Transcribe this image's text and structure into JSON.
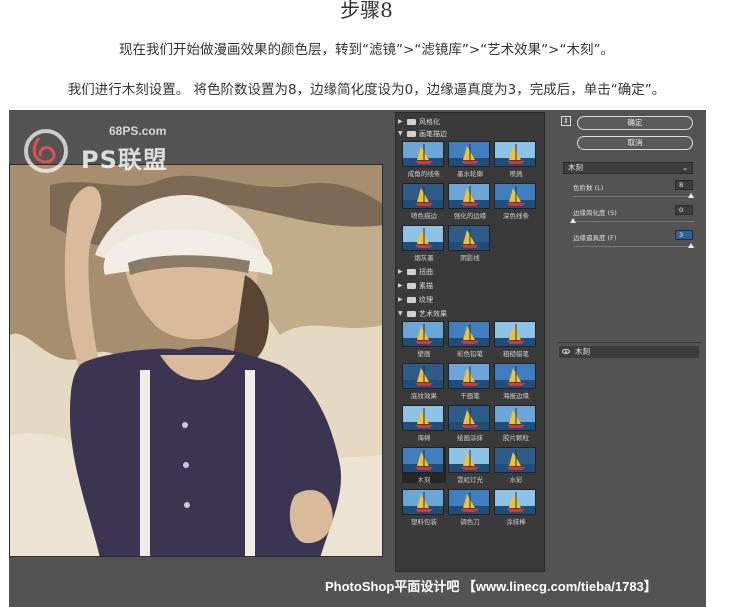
{
  "article": {
    "step_title": "步骤8",
    "paragraph1": "现在我们开始做漫画效果的颜色层，转到“滤镜”>“滤镜库”>“艺术效果”>“木刻”。",
    "paragraph2": "我们进行木刻设置。 将色阶数设置为8，边缘简化度设为0，边缘逼真度为3，完成后，单击“确定”。"
  },
  "watermark": {
    "site": "68PS.com",
    "brand": "PS联盟",
    "bottom_text": "PhotoShop平面设计吧 【www.linecg.com/tieba/1783】"
  },
  "filter_gallery": {
    "categories": [
      {
        "label": "风格化",
        "expanded": false
      },
      {
        "label": "画笔描边",
        "expanded": true,
        "items": [
          "成角的线条",
          "墨水轮廓",
          "喷溅",
          "喷色描边",
          "强化的边缘",
          "深色线条",
          "烟灰墨",
          "阴影线"
        ]
      },
      {
        "label": "扭曲",
        "expanded": false
      },
      {
        "label": "素描",
        "expanded": false
      },
      {
        "label": "纹理",
        "expanded": false
      },
      {
        "label": "艺术效果",
        "expanded": true,
        "items": [
          "壁画",
          "彩色铅笔",
          "粗糙蜡笔",
          "底纹效果",
          "干画笔",
          "海报边缘",
          "海绵",
          "绘画涂抹",
          "胶片颗粒",
          "木刻",
          "霓虹灯光",
          "水彩",
          "塑料包装",
          "调色刀",
          "涂抹棒"
        ]
      }
    ],
    "selected_item": "木刻"
  },
  "settings": {
    "ok_label": "确定",
    "cancel_label": "取消",
    "filter_name": "木刻",
    "params": [
      {
        "label": "色阶数 (L)",
        "value": "8"
      },
      {
        "label": "边缘简化度 (S)",
        "value": "0"
      },
      {
        "label": "边缘逼真度 (F)",
        "value": "3"
      }
    ]
  },
  "layers": {
    "items": [
      {
        "label": "木刻"
      }
    ]
  },
  "colors": {
    "panel_bg": "#535353",
    "list_bg": "#3a3a3a",
    "selected_value": "#2f5f9e"
  }
}
